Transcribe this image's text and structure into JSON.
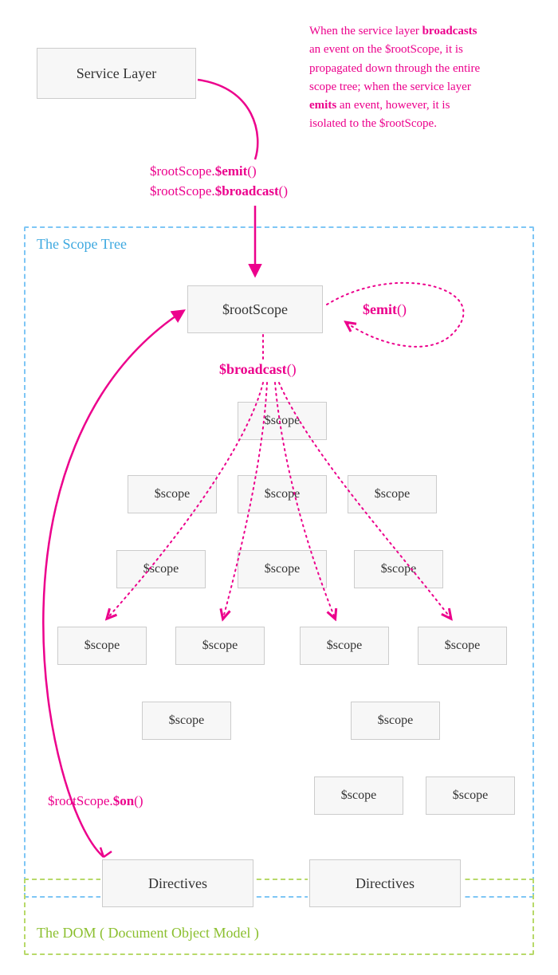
{
  "colors": {
    "pink": "#ec008c",
    "blue_dash": "#7ec6f5",
    "green_dash": "#b8d96a",
    "blue_label": "#3ea9e0",
    "green_label": "#8bbf2e",
    "box_border": "#ccc",
    "box_fill": "#f7f7f7",
    "text": "#333"
  },
  "description": {
    "line1_a": "When the service layer ",
    "line1_b": "broadcasts",
    "line2": "an event on the $rootScope, it is",
    "line3": "propagated down through the entire",
    "line4": "scope tree; when the service layer",
    "line5_a": "emits",
    "line5_b": " an event, however, it is",
    "line6": "isolated to the $rootScope."
  },
  "serviceLayerBox": "Service Layer",
  "emitCall_a": "$rootScope.",
  "emitCall_b": "$emit",
  "emitCall_c": "()",
  "broadcastCall_a": "$rootScope.",
  "broadcastCall_b": "$broadcast",
  "broadcastCall_c": "()",
  "scopeTreeLabel": "The Scope Tree",
  "rootScopeBox": "$rootScope",
  "emitLoopLabel_a": "$emit",
  "emitLoopLabel_b": "()",
  "broadcastLabel_a": "$broadcast",
  "broadcastLabel_b": "()",
  "scopeLabel": "$scope",
  "onCall_a": "$rootScope.",
  "onCall_b": "$on",
  "onCall_c": "()",
  "directivesLabel": "Directives",
  "domLabel": "The DOM ( Document Object Model )"
}
